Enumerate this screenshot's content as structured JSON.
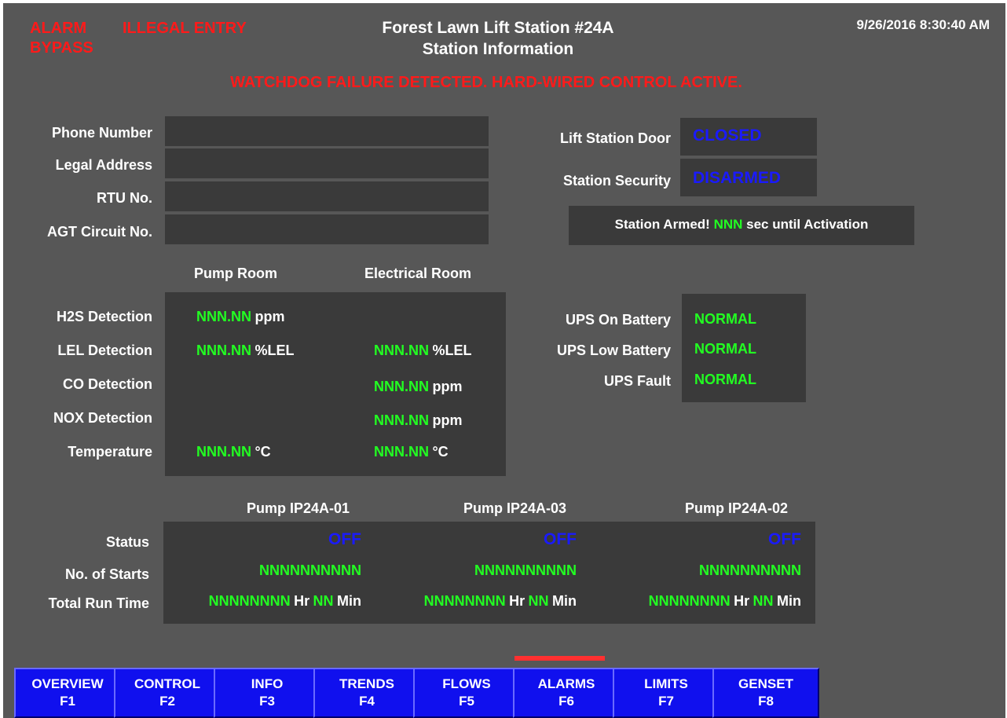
{
  "header": {
    "alarm_line1": "ALARM",
    "alarm_line2": "BYPASS",
    "illegal_entry": "ILLEGAL ENTRY",
    "title_line1": "Forest Lawn Lift Station #24A",
    "title_line2": "Station Information",
    "datetime": "9/26/2016 8:30:40 AM",
    "watchdog": "WATCHDOG FAILURE DETECTED. HARD-WIRED CONTROL ACTIVE."
  },
  "info": {
    "phone_label": "Phone Number",
    "address_label": "Legal Address",
    "rtu_label": "RTU No.",
    "agt_label": "AGT Circuit No.",
    "phone_value": "",
    "address_value": "",
    "rtu_value": "",
    "agt_value": ""
  },
  "security": {
    "door_label": "Lift Station Door",
    "door_value": "CLOSED",
    "security_label": "Station Security",
    "security_value": "DISARMED",
    "armed_prefix": "Station Armed!",
    "armed_value": "NNN",
    "armed_suffix": "sec until Activation"
  },
  "gas": {
    "pump_room_header": "Pump Room",
    "elec_room_header": "Electrical Room",
    "rows": [
      {
        "label": "H2S Detection",
        "pump_value": "NNN.NN",
        "pump_unit": "ppm",
        "elec_value": "",
        "elec_unit": ""
      },
      {
        "label": "LEL Detection",
        "pump_value": "NNN.NN",
        "pump_unit": "%LEL",
        "elec_value": "NNN.NN",
        "elec_unit": "%LEL"
      },
      {
        "label": "CO Detection",
        "pump_value": "",
        "pump_unit": "",
        "elec_value": "NNN.NN",
        "elec_unit": "ppm"
      },
      {
        "label": "NOX Detection",
        "pump_value": "",
        "pump_unit": "",
        "elec_value": "NNN.NN",
        "elec_unit": "ppm"
      },
      {
        "label": "Temperature",
        "pump_value": "NNN.NN",
        "pump_unit": "°C",
        "elec_value": "NNN.NN",
        "elec_unit": "°C"
      }
    ]
  },
  "ups": {
    "on_battery_label": "UPS On Battery",
    "on_battery_value": "NORMAL",
    "low_battery_label": "UPS Low Battery",
    "low_battery_value": "NORMAL",
    "fault_label": "UPS Fault",
    "fault_value": "NORMAL"
  },
  "pumps": {
    "status_label": "Status",
    "starts_label": "No. of Starts",
    "runtime_label": "Total Run Time",
    "hr_label": "Hr",
    "min_label": "Min",
    "items": [
      {
        "name": "Pump IP24A-01",
        "status": "OFF",
        "starts": "NNNNNNNNNN",
        "hours": "NNNNNNNN",
        "minutes": "NN"
      },
      {
        "name": "Pump IP24A-03",
        "status": "OFF",
        "starts": "NNNNNNNNNN",
        "hours": "NNNNNNNN",
        "minutes": "NN"
      },
      {
        "name": "Pump IP24A-02",
        "status": "OFF",
        "starts": "NNNNNNNNNN",
        "hours": "NNNNNNNN",
        "minutes": "NN"
      }
    ]
  },
  "nav": {
    "buttons": [
      {
        "label": "OVERVIEW",
        "key": "F1"
      },
      {
        "label": "CONTROL",
        "key": "F2"
      },
      {
        "label": "INFO",
        "key": "F3"
      },
      {
        "label": "TRENDS",
        "key": "F4"
      },
      {
        "label": "FLOWS",
        "key": "F5"
      },
      {
        "label": "ALARMS",
        "key": "F6"
      },
      {
        "label": "LIMITS",
        "key": "F7"
      },
      {
        "label": "GENSET",
        "key": "F8"
      }
    ]
  },
  "colors": {
    "background": "#575757",
    "panel": "#3a3a3a",
    "alarm_red": "#ff1a1a",
    "value_green": "#22ff22",
    "status_blue": "#1a1aff",
    "button_blue": "#1010ee"
  }
}
